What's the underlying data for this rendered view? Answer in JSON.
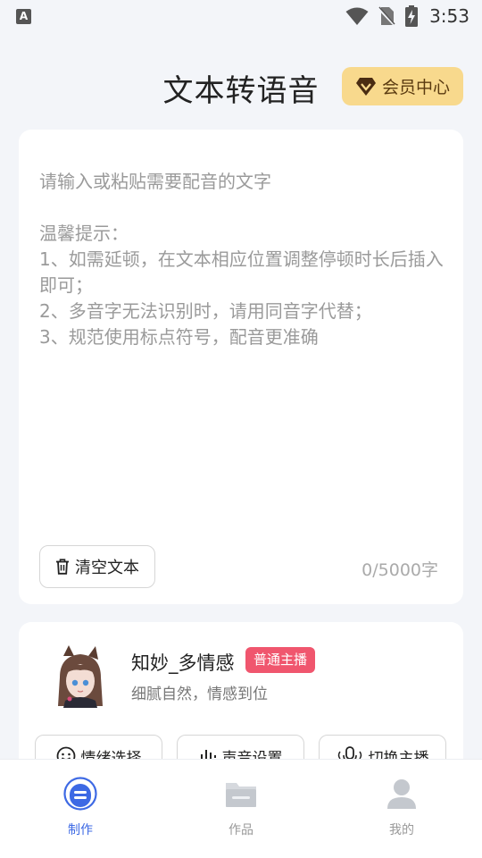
{
  "status_bar": {
    "time": "3:53",
    "notification_icon": "A"
  },
  "header": {
    "title": "文本转语音",
    "vip_label": "会员中心"
  },
  "editor": {
    "placeholder": "请输入或粘贴需要配音的文字\n\n温馨提示：\n1、如需延顿，在文本相应位置调整停顿时长后插入即可；\n2、多音字无法识别时，请用同音字代替；\n3、规范使用标点符号，配音更准确",
    "clear_label": "清空文本",
    "char_count": "0/5000字"
  },
  "voice": {
    "name": "知妙_多情感",
    "badge": "普通主播",
    "description": "细腻自然，情感到位",
    "options": [
      "情绪选择",
      "声音设置",
      "切换主播"
    ]
  },
  "nav": [
    {
      "label": "制作",
      "icon": "robot-icon",
      "active": true
    },
    {
      "label": "作品",
      "icon": "folder-icon",
      "active": false
    },
    {
      "label": "我的",
      "icon": "user-icon",
      "active": false
    }
  ],
  "colors": {
    "accent": "#3d69e4",
    "vip_bg": "#f8d98d",
    "badge": "#f0566e",
    "background": "#f3f5f9"
  }
}
